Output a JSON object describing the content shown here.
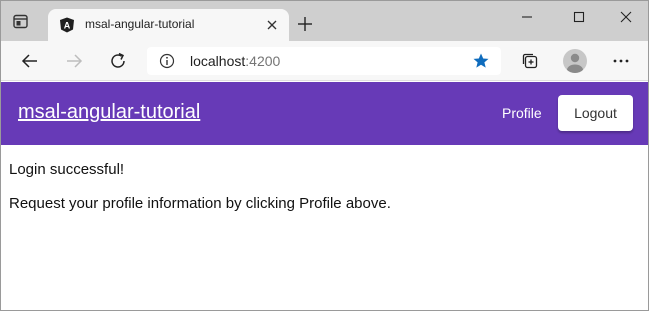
{
  "browser": {
    "tab": {
      "title": "msal-angular-tutorial",
      "favicon": "angular-logo-icon"
    },
    "address": {
      "host": "localhost",
      "port": ":4200"
    },
    "icons": {
      "tab_actions": "tab-actions-icon",
      "close_tab": "close-icon",
      "new_tab": "plus-icon",
      "minimize": "minimize-icon",
      "maximize": "maximize-icon",
      "close_window": "close-icon",
      "back": "back-arrow-icon",
      "forward": "forward-arrow-icon",
      "reload": "reload-icon",
      "site_info": "info-icon",
      "favorite": "star-icon",
      "collections": "collections-icon",
      "profile": "avatar-icon",
      "more": "more-icon"
    },
    "colors": {
      "favorite_star": "#0f6cbd"
    }
  },
  "app": {
    "title": "msal-angular-tutorial",
    "nav": {
      "profile": "Profile",
      "logout": "Logout"
    },
    "colors": {
      "toolbar": "#673ab7"
    }
  },
  "content": {
    "status": "Login successful!",
    "instruction": "Request your profile information by clicking Profile above."
  }
}
